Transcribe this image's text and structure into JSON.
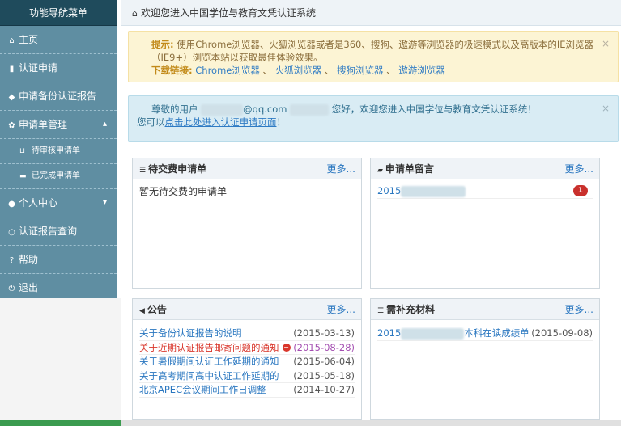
{
  "sidebar": {
    "title": "功能导航菜单",
    "items": [
      {
        "icon": "home-icon",
        "glyph": "⌂",
        "label": "主页"
      },
      {
        "icon": "file-icon",
        "glyph": "▮",
        "label": "认证申请"
      },
      {
        "icon": "tag-icon",
        "glyph": "◆",
        "label": "申请备份认证报告"
      },
      {
        "icon": "gear-icon",
        "glyph": "✿",
        "label": "申请单管理",
        "chevron": "▴"
      },
      {
        "icon": "cart-icon",
        "glyph": "⊔",
        "label": "待审核申请单"
      },
      {
        "icon": "briefcase-icon",
        "glyph": "▬",
        "label": "已完成申请单"
      },
      {
        "icon": "user-icon",
        "glyph": "●",
        "label": "个人中心",
        "chevron": "▾"
      },
      {
        "icon": "search-icon",
        "glyph": "○",
        "label": "认证报告查询"
      },
      {
        "icon": "help-icon",
        "glyph": "?",
        "label": "帮助"
      },
      {
        "icon": "power-icon",
        "glyph": "⏻",
        "label": "退出"
      }
    ]
  },
  "header": {
    "home_glyph": "⌂",
    "title": "欢迎您进入中国学位与教育文凭认证系统"
  },
  "alerts": {
    "browser": {
      "label": "提示:",
      "text": "使用Chrome浏览器、火狐浏览器或者是360、搜狗、遨游等浏览器的极速模式以及高版本的IE浏览器（IE9+）浏览本站以获取最佳体验效果。",
      "download_label": "下载链接:",
      "links": [
        "Chrome浏览器",
        "火狐浏览器",
        "搜狗浏览器",
        "遨游浏览器"
      ],
      "sep": "、",
      "close": "×"
    },
    "welcome": {
      "prefix": "尊敬的用户",
      "email_domain": "@qq.com",
      "greeting": "您好，欢迎您进入中国学位与教育文凭认证系统！",
      "line2_prefix": "您可以",
      "line2_link": "点击此处进入认证申请页面",
      "line2_suffix": "！",
      "close": "×"
    }
  },
  "panels": {
    "pending": {
      "icon_glyph": "☰",
      "title": "待交费申请单",
      "more": "更多...",
      "empty": "暂无待交费的申请单"
    },
    "messages": {
      "icon_glyph": "▰",
      "title": "申请单留言",
      "more": "更多...",
      "item_prefix": "2015",
      "badge": "1"
    },
    "notices": {
      "icon_glyph": "◀",
      "title": "公告",
      "more": "更多...",
      "new_glyph": "−",
      "items": [
        {
          "title": "关于备份认证报告的说明",
          "date": "(2015-03-13)"
        },
        {
          "title": "关于近期认证报告邮寄问题的通知",
          "date": "(2015-08-28)"
        },
        {
          "title": "关于暑假期间认证工作延期的通知",
          "date": "(2015-06-04)"
        },
        {
          "title": "关于高考期间高中认证工作延期的",
          "date": "(2015-05-18)"
        },
        {
          "title": "北京APEC会议期间工作日调整",
          "date": "(2014-10-27)"
        }
      ]
    },
    "materials": {
      "icon_glyph": "☰",
      "title": "需补充材料",
      "more": "更多...",
      "item_prefix": "2015",
      "item_suffix": "本科在读成绩单",
      "item_date": "(2015-09-08)"
    }
  }
}
